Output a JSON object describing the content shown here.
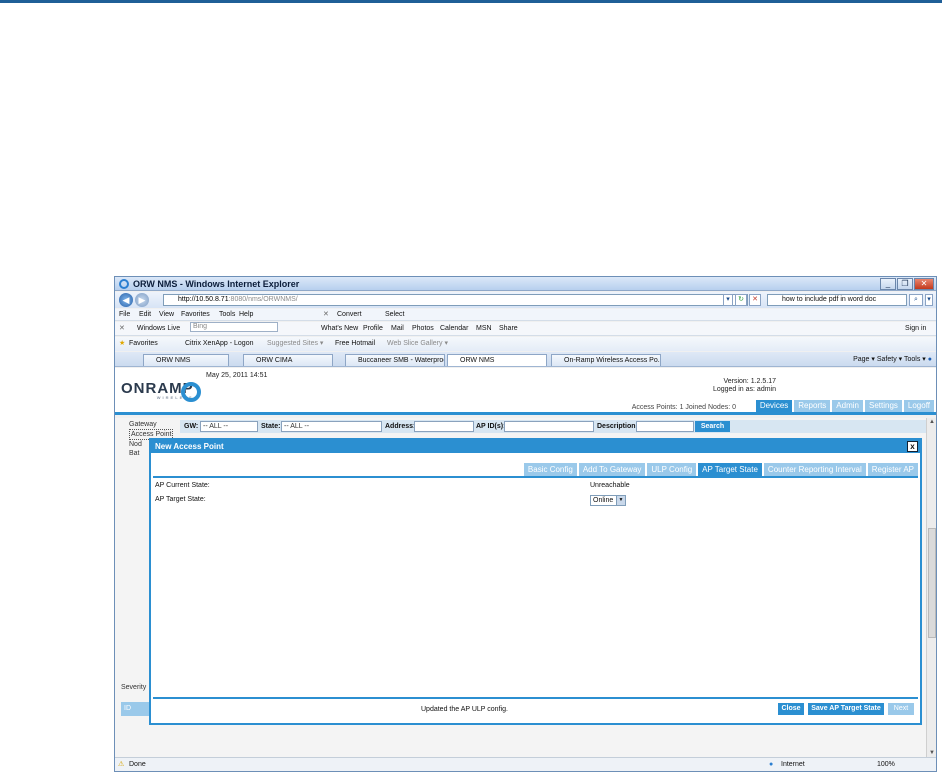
{
  "browser": {
    "title": "ORW NMS - Windows Internet Explorer",
    "address_host": "http://10.50.8.71",
    "address_path": ":8080/nms/ORWNMS/",
    "search_text": "how to include pdf in word doc",
    "menu": [
      "File",
      "Edit",
      "View",
      "Favorites",
      "Tools",
      "Help"
    ],
    "menu_extras": [
      "Convert",
      "Select"
    ],
    "links": {
      "windows_live": "Windows Live",
      "search_placeholder": "Bing",
      "items": [
        "What's New",
        "Profile",
        "Mail",
        "Photos",
        "Calendar",
        "MSN",
        "Share"
      ],
      "signin": "Sign in"
    },
    "favorites": {
      "label": "Favorites",
      "items": [
        "Citrix XenApp - Logon",
        "Suggested Sites ▾",
        "Free Hotmail",
        "Web Slice Gallery ▾"
      ]
    },
    "tabs": [
      "ORW NMS",
      "ORW CIMA",
      "Buccaneer SMB - Waterproof...",
      "ORW NMS",
      "On-Ramp Wireless Access Po..."
    ],
    "commands": [
      "Page ▾",
      "Safety ▾",
      "Tools ▾"
    ],
    "status": {
      "left": "Done",
      "zone": "Internet",
      "zoom": "100%"
    }
  },
  "app": {
    "logo": "ONRAMP",
    "logo_sub": "WIRELESS",
    "datetime": "May 25, 2011 14:51",
    "version": "Version: 1.2.5.17",
    "logged_in": "Logged in as: admin",
    "counts": "Access Points: 1 Joined Nodes: 0",
    "nav": [
      "Devices",
      "Reports",
      "Admin",
      "Settings",
      "Logoff"
    ],
    "sidebar": [
      "Gateway",
      "Access Point",
      "Nod",
      "Bat"
    ],
    "filters": {
      "gw_label": "GW:",
      "gw_value": "-- ALL --",
      "state_label": "State:",
      "state_value": "-- ALL --",
      "address_label": "Address:",
      "apid_label": "AP ID(s):",
      "description_label": "Description:",
      "search_button": "Search"
    },
    "severity_label": "Severity",
    "id_header": "ID"
  },
  "modal": {
    "title": "New Access Point",
    "close_glyph": "x",
    "tabs": [
      "Basic Config",
      "Add To Gateway",
      "ULP Config",
      "AP Target State",
      "Counter Reporting Interval",
      "Register AP"
    ],
    "active_tab_index": 3,
    "current_state_label": "AP Current State:",
    "current_state_value": "Unreachable",
    "target_state_label": "AP Target State:",
    "target_state_value": "Online",
    "message": "Updated the AP ULP config.",
    "buttons": {
      "close": "Close",
      "save": "Save AP Target State",
      "next": "Next"
    }
  }
}
